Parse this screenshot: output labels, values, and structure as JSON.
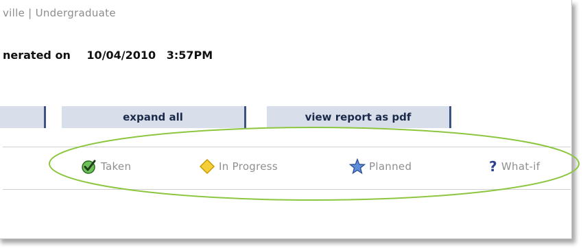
{
  "header": {
    "campus_program": "ville | Undergraduate"
  },
  "report": {
    "generated_label": "nerated on",
    "generated_date": "10/04/2010",
    "generated_time": "3:57PM"
  },
  "toolbar": {
    "prev_label": "",
    "expand_label": "expand all",
    "pdf_label": "view report as pdf"
  },
  "legend": {
    "taken": {
      "label": "Taken",
      "icon": "check-circle-icon",
      "color": "#2e8b2e"
    },
    "in_progress": {
      "label": "In Progress",
      "icon": "diamond-icon",
      "color": "#f2c200"
    },
    "planned": {
      "label": "Planned",
      "icon": "star-icon",
      "color": "#4a78c8"
    },
    "what_if": {
      "symbol": "?",
      "label": "What-if",
      "icon": "question-icon",
      "color": "#2f3f8f"
    }
  },
  "annotation": {
    "highlight_color": "#8cc63f"
  }
}
